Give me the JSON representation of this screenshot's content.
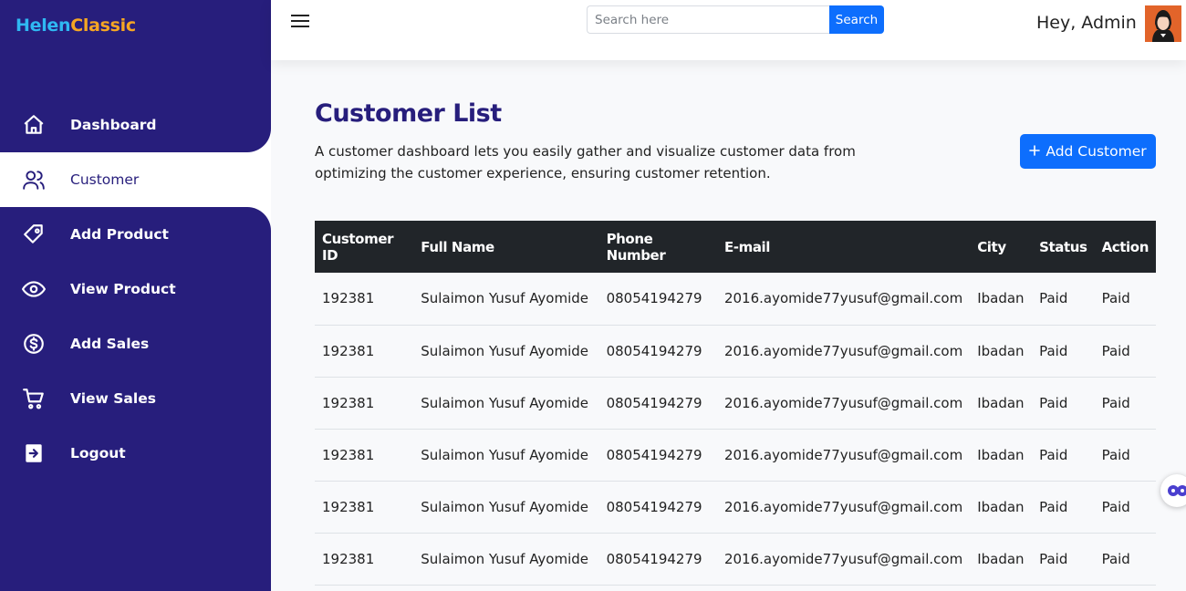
{
  "brand": {
    "part1": "Helen",
    "part2": "Classic"
  },
  "sidebar": {
    "items": [
      {
        "label": "Dashboard",
        "icon": "home-icon"
      },
      {
        "label": "Customer",
        "icon": "users-icon"
      },
      {
        "label": "Add Product",
        "icon": "tag-icon"
      },
      {
        "label": "View Product",
        "icon": "eye-icon"
      },
      {
        "label": "Add Sales",
        "icon": "dollar-circle-icon"
      },
      {
        "label": "View Sales",
        "icon": "cart-icon"
      },
      {
        "label": "Logout",
        "icon": "logout-icon"
      }
    ],
    "active_index": 1
  },
  "topbar": {
    "search_placeholder": "Search here",
    "search_button": "Search",
    "greeting": "Hey, Admin"
  },
  "main": {
    "title": "Customer List",
    "description": "A customer dashboard lets you easily gather and visualize customer data from optimizing the customer experience, ensuring customer retention.",
    "add_button": "Add Customer"
  },
  "table": {
    "columns": [
      "Customer ID",
      "Full Name",
      "Phone Number",
      "E-mail",
      "City",
      "Status",
      "Action"
    ],
    "rows": [
      [
        "192381",
        "Sulaimon Yusuf Ayomide",
        "08054194279",
        "2016.ayomide77yusuf@gmail.com",
        "Ibadan",
        "Paid",
        "Paid"
      ],
      [
        "192381",
        "Sulaimon Yusuf Ayomide",
        "08054194279",
        "2016.ayomide77yusuf@gmail.com",
        "Ibadan",
        "Paid",
        "Paid"
      ],
      [
        "192381",
        "Sulaimon Yusuf Ayomide",
        "08054194279",
        "2016.ayomide77yusuf@gmail.com",
        "Ibadan",
        "Paid",
        "Paid"
      ],
      [
        "192381",
        "Sulaimon Yusuf Ayomide",
        "08054194279",
        "2016.ayomide77yusuf@gmail.com",
        "Ibadan",
        "Paid",
        "Paid"
      ],
      [
        "192381",
        "Sulaimon Yusuf Ayomide",
        "08054194279",
        "2016.ayomide77yusuf@gmail.com",
        "Ibadan",
        "Paid",
        "Paid"
      ],
      [
        "192381",
        "Sulaimon Yusuf Ayomide",
        "08054194279",
        "2016.ayomide77yusuf@gmail.com",
        "Ibadan",
        "Paid",
        "Paid"
      ]
    ]
  },
  "colors": {
    "sidebar_bg": "#271e7c",
    "accent": "#0d6efd",
    "table_header": "#212529",
    "brand_blue": "#2fb8f2",
    "brand_orange": "#f5a623"
  }
}
